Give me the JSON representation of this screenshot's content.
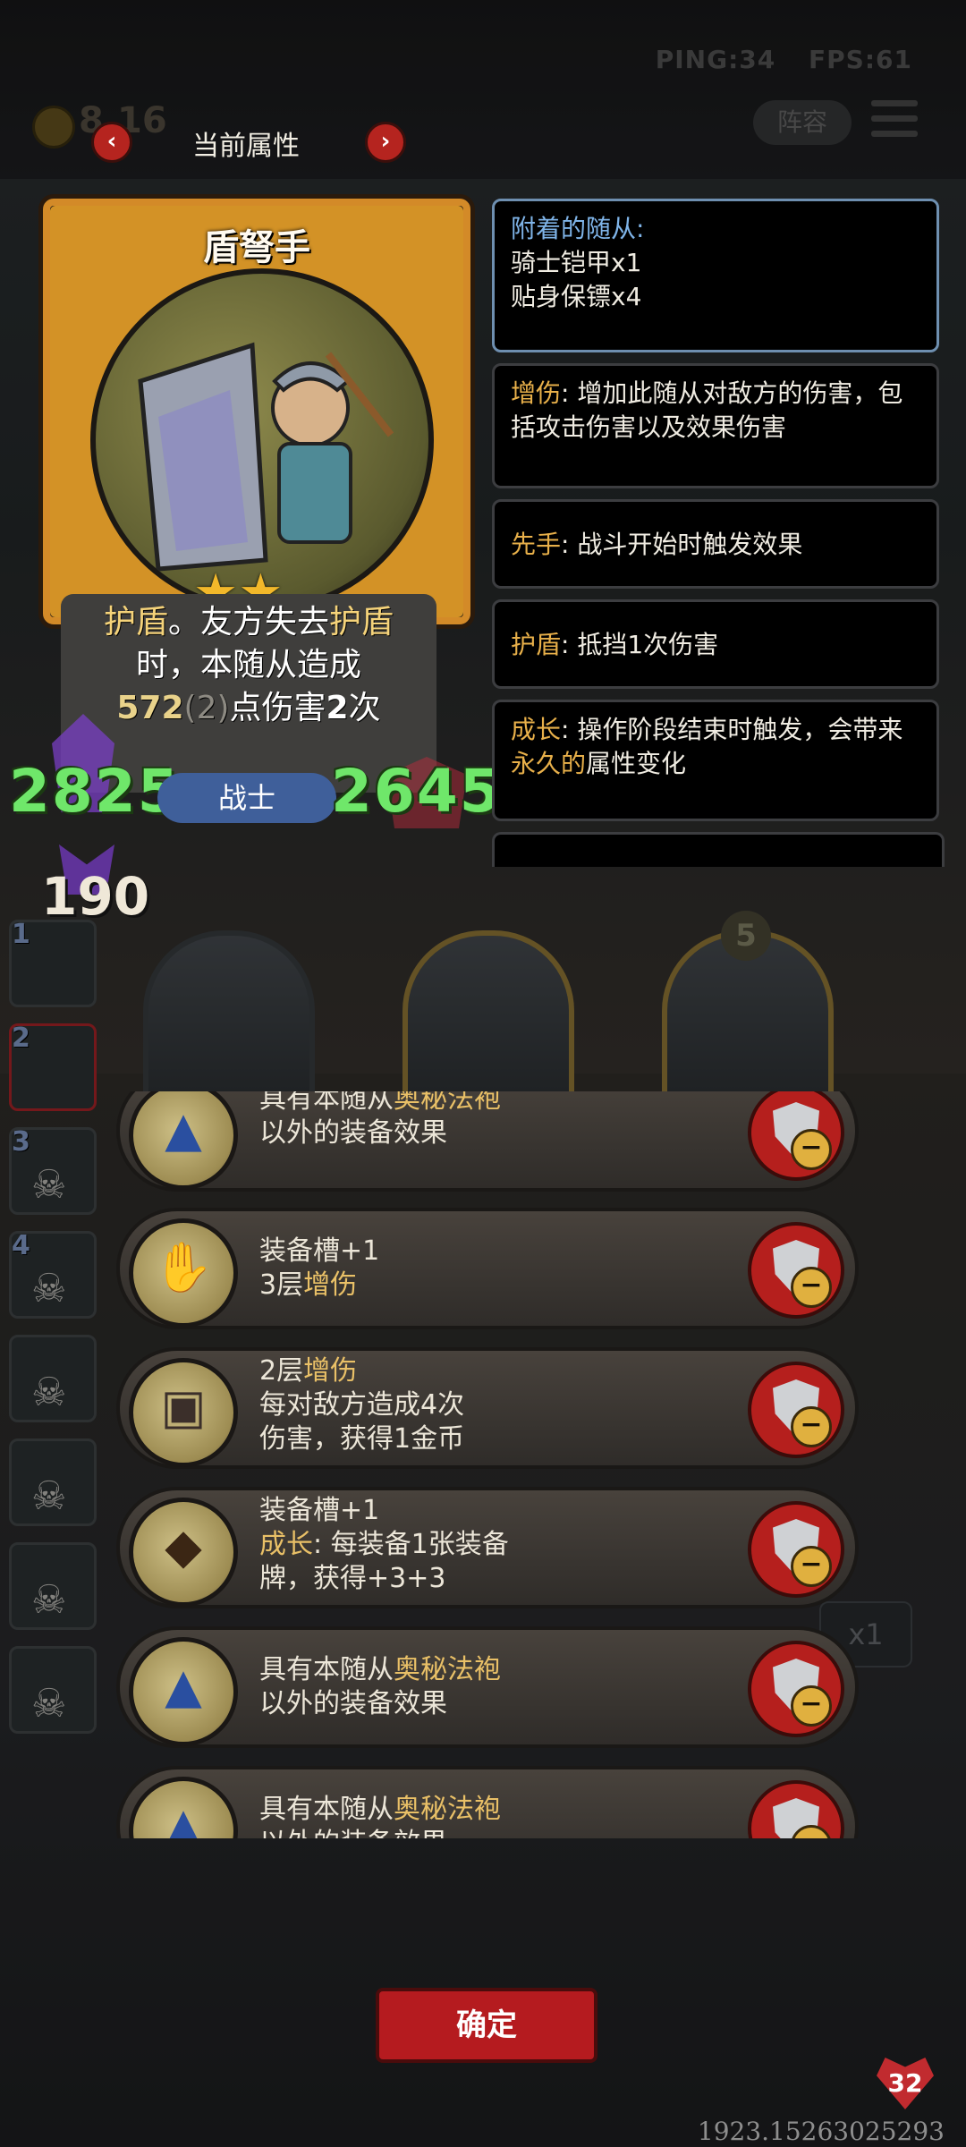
{
  "hud": {
    "ping": "PING:34",
    "fps": "FPS:61",
    "gold": "8.16",
    "lineup_label": "阵容"
  },
  "header": {
    "title": "当前属性",
    "prev": "‹",
    "next": "›"
  },
  "card": {
    "name": "盾弩手",
    "stars": [
      "★",
      "★"
    ],
    "desc": {
      "kw1": "护盾",
      "t1": "。友方失去",
      "kw2": "护盾",
      "t2": "时，本随从造成",
      "num": "572",
      "paren": "(2)",
      "t3": "点伤害",
      "count": "2",
      "t4": "次"
    },
    "attack": "2825",
    "hp": "2645",
    "class": "战士",
    "extra": "190"
  },
  "keywords": {
    "attached_head": "附着的随从:",
    "attached_items": [
      "骑士铠甲x1",
      "贴身保镖x4"
    ],
    "list": [
      {
        "name": "增伤",
        "desc": ": 增加此随从对敌方的伤害，包括攻击伤害以及效果伤害"
      },
      {
        "name": "先手",
        "desc": ": 战斗开始时触发效果"
      },
      {
        "name": "护盾",
        "desc": ": 抵挡1次伤害"
      },
      {
        "name": "成长",
        "desc": ": 操作阶段结束时触发，会带来",
        "highlight": "永久的",
        "tail": "属性变化"
      }
    ]
  },
  "board": {
    "slots": [
      "1",
      "2",
      "3",
      "4",
      "",
      "",
      "",
      ""
    ],
    "turn": "5",
    "speed": "x1"
  },
  "equipment": [
    {
      "icon": "robe-icon",
      "l1a": "具有本随从",
      "l1h": "奥秘法袍",
      "l2": "以外的装备效果"
    },
    {
      "icon": "gauntlet-icon",
      "l1a": "装备槽+1",
      "l1h": "",
      "l2a": "3层",
      "l2h": "增伤"
    },
    {
      "icon": "chest-icon",
      "l1a": "2层",
      "l1h": "增伤",
      "l2": "每对敌方造成4次",
      "l3": "伤害，获得1金币"
    },
    {
      "icon": "armor-icon",
      "l1a": "装备槽+1",
      "l2h": "成长",
      "l2": ": 每装备1张装备",
      "l3": "牌，获得+3+3"
    },
    {
      "icon": "robe-icon",
      "l1a": "具有本随从",
      "l1h": "奥秘法袍",
      "l2": "以外的装备效果"
    },
    {
      "icon": "robe-icon",
      "l1a": "具有本随从",
      "l1h": "奥秘法袍",
      "l2": "以外的装备效果"
    }
  ],
  "minus_glyph": "−",
  "confirm_label": "确定",
  "player_hp": "32",
  "bottom_id": "1923.15263025293"
}
